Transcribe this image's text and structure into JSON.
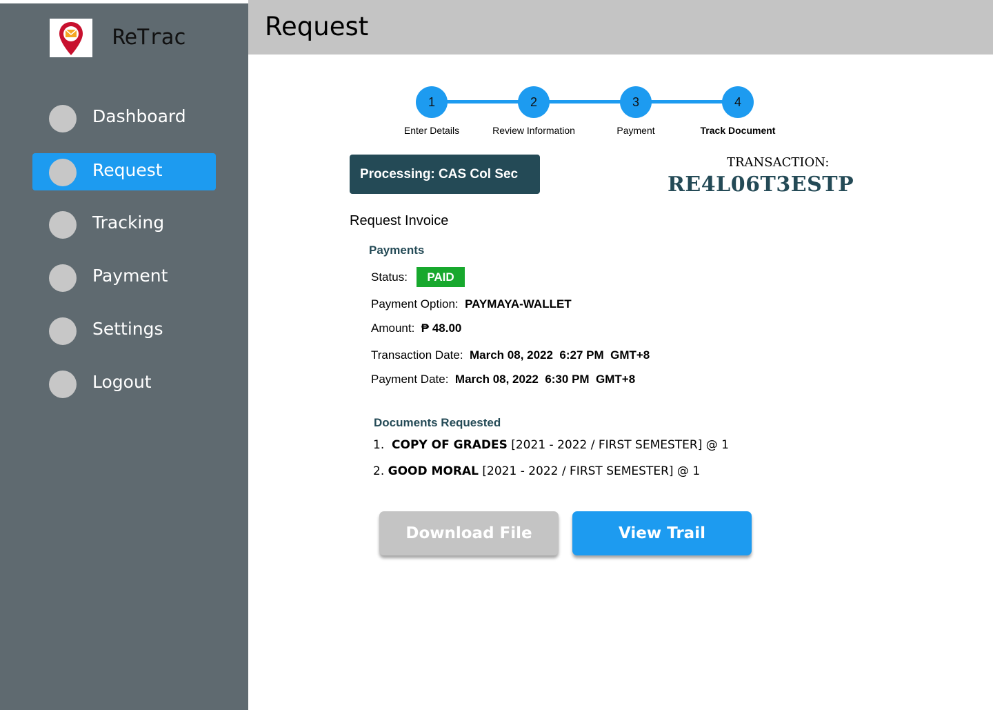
{
  "app": {
    "name": "ReTrac",
    "logo_icon": "location-pin-mail-icon"
  },
  "sidebar": {
    "items": [
      {
        "label": "Dashboard",
        "active": false
      },
      {
        "label": "Request",
        "active": true
      },
      {
        "label": "Tracking",
        "active": false
      },
      {
        "label": "Payment",
        "active": false
      },
      {
        "label": "Settings",
        "active": false
      },
      {
        "label": "Logout",
        "active": false
      }
    ]
  },
  "header": {
    "title": "Request"
  },
  "stepper": {
    "current": 4,
    "steps": [
      {
        "number": "1",
        "label": "Enter Details"
      },
      {
        "number": "2",
        "label": "Review Information"
      },
      {
        "number": "3",
        "label": "Payment"
      },
      {
        "number": "4",
        "label": "Track Document"
      }
    ]
  },
  "processing": {
    "label": "Processing: CAS Col Sec"
  },
  "transaction": {
    "label": "TRANSACTION:",
    "id": "RE4L06T3ESTP"
  },
  "invoice": {
    "title": "Request Invoice",
    "payments_title": "Payments",
    "status_label": "Status:",
    "status_value": "PAID",
    "option_label": "Payment Option:",
    "option_value": "PAYMAYA-WALLET",
    "amount_label": "Amount:",
    "amount_value": "₱ 48.00",
    "txn_date_label": "Transaction Date:",
    "txn_date_value": "March 08, 2022  6:27 PM  GMT+8",
    "pay_date_label": "Payment Date:",
    "pay_date_value": "March 08, 2022  6:30 PM  GMT+8"
  },
  "documents": {
    "title": "Documents Requested",
    "items": [
      {
        "index": "1.",
        "name": "COPY OF GRADES",
        "detail": "[2021 - 2022 / FIRST SEMESTER] @ 1"
      },
      {
        "index": "2.",
        "name": "GOOD MORAL",
        "detail": "[2021 - 2022 / FIRST SEMESTER] @ 1"
      }
    ]
  },
  "actions": {
    "download_label": "Download File",
    "trail_label": "View Trail"
  },
  "colors": {
    "accent": "#1d9bf0",
    "sidebar": "#5f6a70",
    "dark_teal": "#244a56",
    "paid": "#17a82d",
    "header": "#c4c4c4"
  }
}
